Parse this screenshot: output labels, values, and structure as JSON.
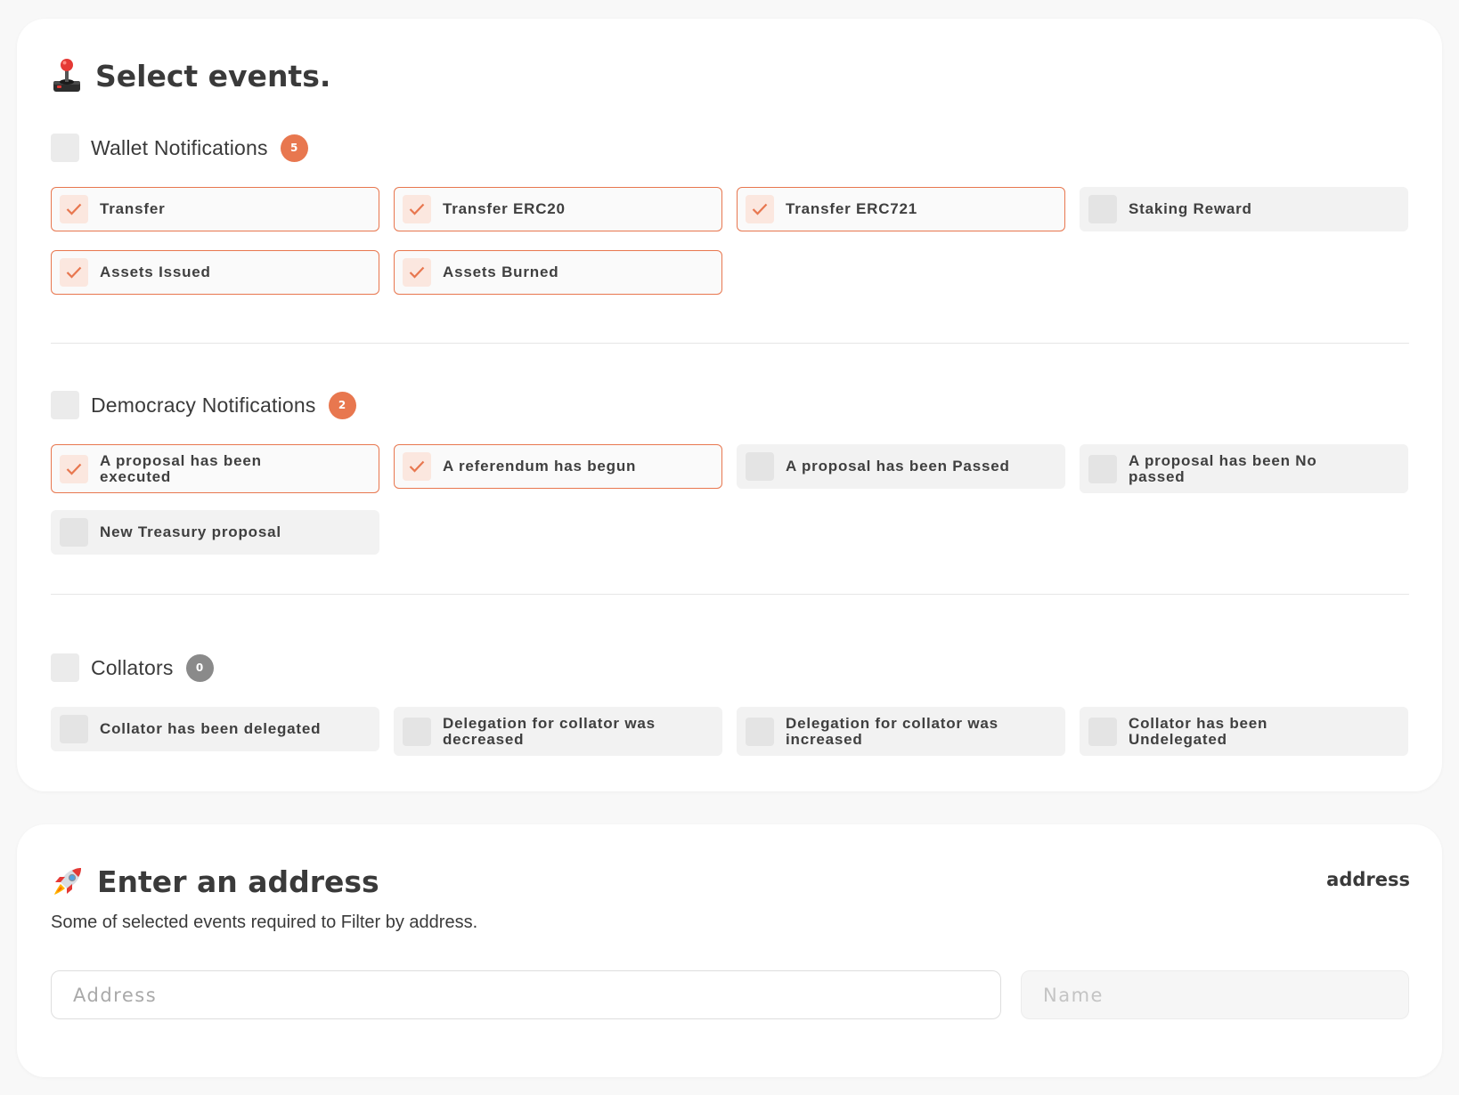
{
  "colors": {
    "accent": "#e8774f",
    "badge_zero": "#8a8a8a",
    "page_bg": "#f8f8f8",
    "card_bg": "#ffffff"
  },
  "events_section": {
    "icon": "joystick-icon",
    "title": "Select events.",
    "groups": [
      {
        "title": "Wallet Notifications",
        "count": "5",
        "checked": false,
        "options": [
          {
            "label": "Transfer",
            "selected": true
          },
          {
            "label": "Transfer ERC20",
            "selected": true
          },
          {
            "label": "Transfer ERC721",
            "selected": true
          },
          {
            "label": "Staking Reward",
            "selected": false
          },
          {
            "label": "Assets Issued",
            "selected": true
          },
          {
            "label": "Assets Burned",
            "selected": true
          }
        ]
      },
      {
        "title": "Democracy Notifications",
        "count": "2",
        "checked": false,
        "options": [
          {
            "label": "A proposal has been executed",
            "selected": true
          },
          {
            "label": "A referendum has begun",
            "selected": true
          },
          {
            "label": "A proposal has been Passed",
            "selected": false
          },
          {
            "label": "A proposal has been No passed",
            "selected": false
          },
          {
            "label": "New Treasury proposal",
            "selected": false
          }
        ]
      },
      {
        "title": "Collators",
        "count": "0",
        "checked": false,
        "options": [
          {
            "label": "Collator has been delegated",
            "selected": false
          },
          {
            "label": "Delegation for collator was decreased",
            "selected": false
          },
          {
            "label": "Delegation for collator was increased",
            "selected": false
          },
          {
            "label": "Collator has been Undelegated",
            "selected": false
          }
        ]
      }
    ]
  },
  "address_section": {
    "icon": "rocket-icon",
    "title": "Enter an address",
    "link_label": "address",
    "subtitle": "Some of selected events required to Filter by address.",
    "address_placeholder": "Address",
    "name_placeholder": "Name",
    "address_value": "",
    "name_value": ""
  }
}
